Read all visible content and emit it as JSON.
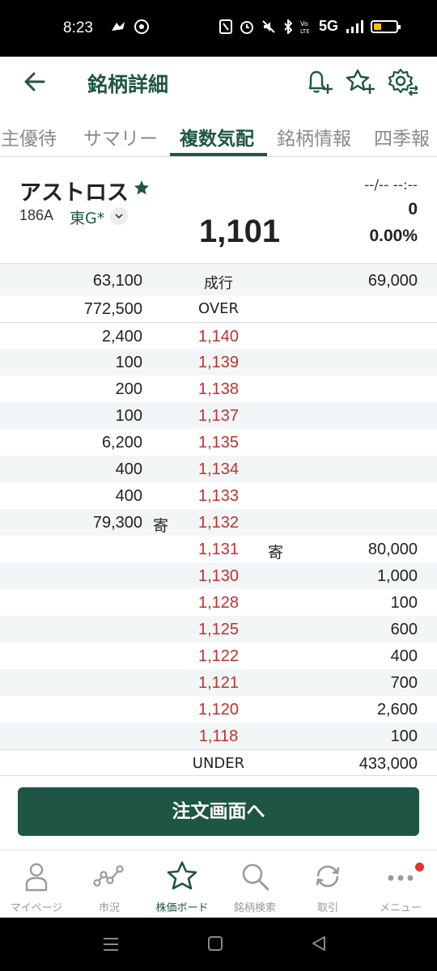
{
  "status_bar": {
    "time": "8:23",
    "network": "5G"
  },
  "header": {
    "title": "銘柄詳細"
  },
  "tabs": [
    {
      "label": "株主優待"
    },
    {
      "label": "サマリー"
    },
    {
      "label": "複数気配"
    },
    {
      "label": "銘柄情報"
    },
    {
      "label": "四季報"
    }
  ],
  "stock": {
    "name": "アストロス",
    "code": "186A",
    "market": "東G*",
    "price": "1,101",
    "time": "--/-- --:--",
    "change": "0",
    "change_pct": "0.00%"
  },
  "board": {
    "market_order": {
      "sell": "63,100",
      "label": "成行",
      "buy": "69,000"
    },
    "over": {
      "sell": "772,500",
      "label": "OVER"
    },
    "asks": [
      {
        "qty": "2,400",
        "price": "1,140",
        "mark": ""
      },
      {
        "qty": "100",
        "price": "1,139",
        "mark": ""
      },
      {
        "qty": "200",
        "price": "1,138",
        "mark": ""
      },
      {
        "qty": "100",
        "price": "1,137",
        "mark": ""
      },
      {
        "qty": "6,200",
        "price": "1,135",
        "mark": ""
      },
      {
        "qty": "400",
        "price": "1,134",
        "mark": ""
      },
      {
        "qty": "400",
        "price": "1,133",
        "mark": ""
      },
      {
        "qty": "79,300",
        "price": "1,132",
        "mark": "寄"
      }
    ],
    "bids": [
      {
        "price": "1,131",
        "qty": "80,000",
        "mark": "寄"
      },
      {
        "price": "1,130",
        "qty": "1,000",
        "mark": ""
      },
      {
        "price": "1,128",
        "qty": "100",
        "mark": ""
      },
      {
        "price": "1,125",
        "qty": "600",
        "mark": ""
      },
      {
        "price": "1,122",
        "qty": "400",
        "mark": ""
      },
      {
        "price": "1,121",
        "qty": "700",
        "mark": ""
      },
      {
        "price": "1,120",
        "qty": "2,600",
        "mark": ""
      },
      {
        "price": "1,118",
        "qty": "100",
        "mark": ""
      }
    ],
    "under": {
      "label": "UNDER",
      "buy": "433,000"
    }
  },
  "order_button": {
    "label": "注文画面へ"
  },
  "bottom_nav": [
    {
      "label": "マイページ",
      "icon": "person-icon"
    },
    {
      "label": "市況",
      "icon": "chart-line-icon"
    },
    {
      "label": "株価ボード",
      "icon": "star-icon"
    },
    {
      "label": "銘柄検索",
      "icon": "search-icon"
    },
    {
      "label": "取引",
      "icon": "refresh-icon"
    },
    {
      "label": "メニュー",
      "icon": "more-icon"
    }
  ],
  "colors": {
    "brand": "#1f5545",
    "ask_price": "#c23030",
    "notification": "#e0342d"
  }
}
